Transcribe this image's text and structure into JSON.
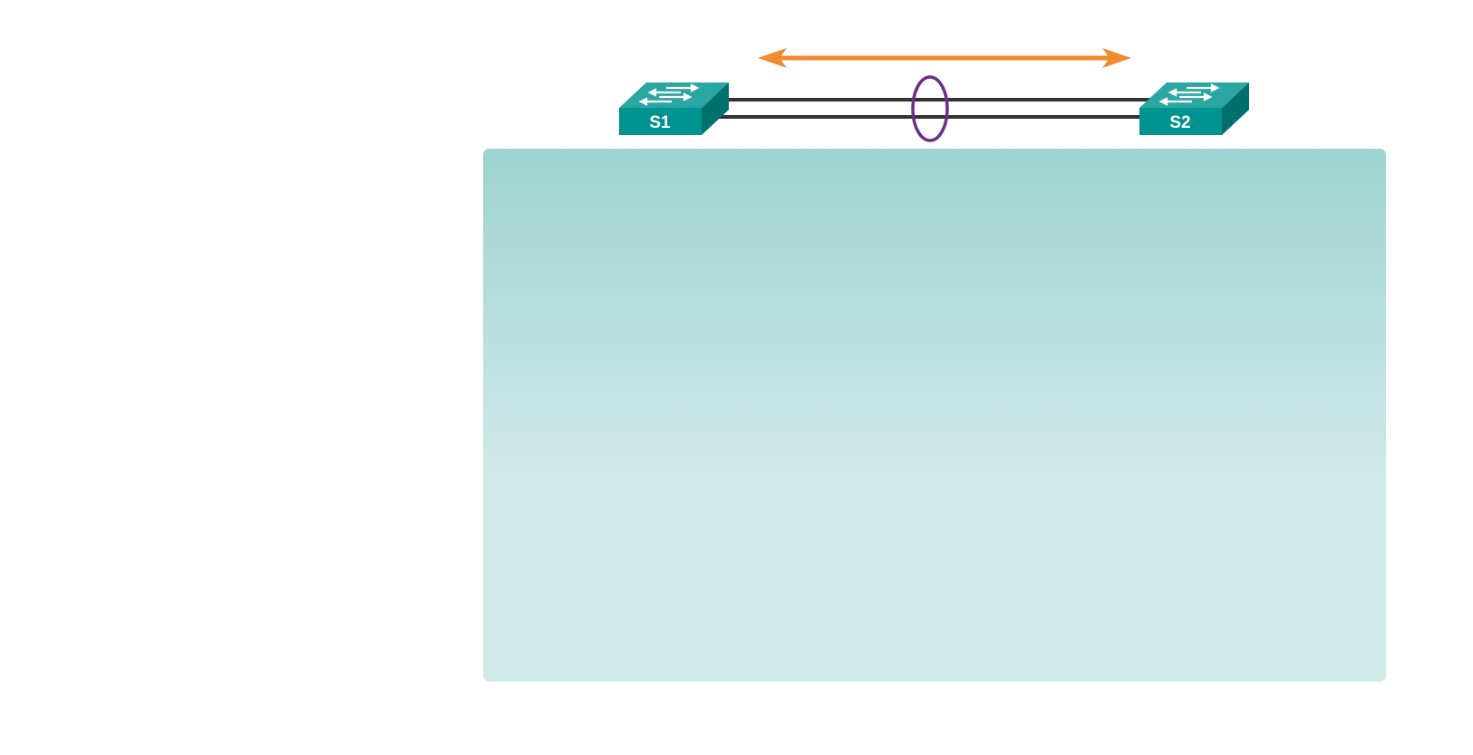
{
  "diagram": {
    "switches": [
      {
        "id": "switch-s1",
        "label": "S1"
      },
      {
        "id": "switch-s2",
        "label": "S2"
      }
    ],
    "links": [
      {
        "from": "S1",
        "to": "S2"
      },
      {
        "from": "S1",
        "to": "S2"
      }
    ],
    "bundle_marker": "etherchannel-ellipse-icon",
    "arrow": "double-headed-arrow-icon",
    "panel": "info-panel"
  },
  "colors": {
    "switch_front": "#009390",
    "switch_top": "#2ba7a3",
    "switch_side": "#00706d",
    "link": "#333333",
    "ellipse": "#6b2f86",
    "arrow": "#f18a30",
    "panel_top": "#9dd4d1",
    "panel_bottom": "#d0e9e8"
  }
}
